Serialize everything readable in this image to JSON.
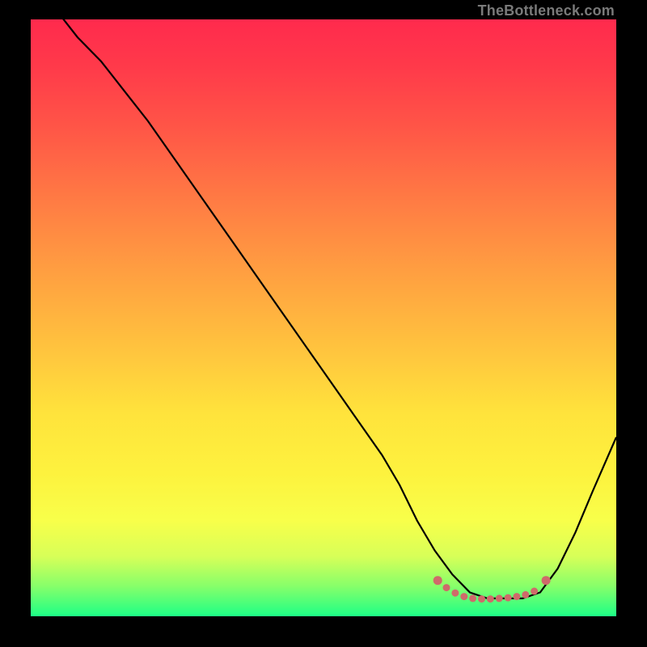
{
  "watermark": "TheBottleneck.com",
  "colors": {
    "frame": "#000000",
    "curve": "#000000",
    "dots": "#cf6a6a"
  },
  "chart_data": {
    "type": "line",
    "title": "",
    "xlabel": "",
    "ylabel": "",
    "xlim": [
      0,
      100
    ],
    "ylim": [
      0,
      100
    ],
    "grid": false,
    "legend": false,
    "series": [
      {
        "name": "bottleneck-curve",
        "x": [
          0,
          4,
          8,
          12,
          16,
          20,
          25,
          30,
          35,
          40,
          45,
          50,
          55,
          60,
          63,
          66,
          69,
          72,
          75,
          78,
          81,
          84,
          87,
          90,
          93,
          96,
          100
        ],
        "y": [
          110,
          102,
          97,
          93,
          88,
          83,
          76,
          69,
          62,
          55,
          48,
          41,
          34,
          27,
          22,
          16,
          11,
          7,
          4,
          3,
          3,
          3,
          4,
          8,
          14,
          21,
          30
        ]
      }
    ],
    "highlight_points": {
      "name": "optimal-range-dots",
      "x": [
        69.5,
        71,
        72.5,
        74,
        75.5,
        77,
        78.5,
        80,
        81.5,
        83,
        84.5,
        86,
        88
      ],
      "y": [
        6.0,
        4.8,
        3.9,
        3.3,
        3.0,
        2.9,
        2.9,
        3.0,
        3.1,
        3.3,
        3.6,
        4.2,
        6.0
      ]
    }
  }
}
